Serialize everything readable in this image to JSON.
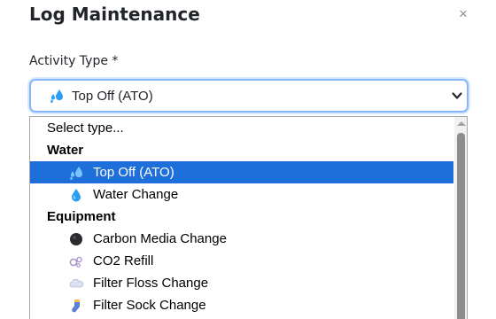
{
  "modal": {
    "title": "Log Maintenance",
    "close_glyph": "×"
  },
  "field": {
    "label": "Activity Type *",
    "selected_value": "Top Off (ATO)",
    "selected_icon": "water-drops-icon"
  },
  "dropdown": {
    "placeholder": "Select type...",
    "groups": [
      {
        "label": "Water",
        "options": [
          {
            "label": "Top Off (ATO)",
            "icon": "water-drops-icon",
            "selected": true
          },
          {
            "label": "Water Change",
            "icon": "water-drop-icon",
            "selected": false
          }
        ]
      },
      {
        "label": "Equipment",
        "options": [
          {
            "label": "Carbon Media Change",
            "icon": "black-circle-icon",
            "selected": false
          },
          {
            "label": "CO2 Refill",
            "icon": "bubbles-icon",
            "selected": false
          },
          {
            "label": "Filter Floss Change",
            "icon": "cloud-icon",
            "selected": false
          },
          {
            "label": "Filter Sock Change",
            "icon": "sock-icon",
            "selected": false
          }
        ]
      }
    ]
  },
  "colors": {
    "selected_bg": "#1e6fd9",
    "focus_border": "#86b7fe",
    "water_icon": "#2a9df4"
  }
}
